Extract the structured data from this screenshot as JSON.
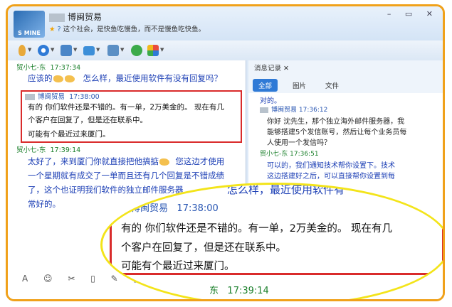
{
  "window": {
    "contact_name": "博闽贸易",
    "signature": "这个社会，是快鱼吃慢鱼，而不是慢鱼吃快鱼。",
    "logo_text": "S MINE",
    "controls": "– ▭ ✕"
  },
  "toolbar": {
    "icons": [
      "microphone-icon",
      "video-icon",
      "screen-icon",
      "folder-icon",
      "remote-icon",
      "add-app-icon",
      "apps-icon"
    ]
  },
  "chat": {
    "messages": [
      {
        "sender": "贸小七-东",
        "time": "17:37:34",
        "text_a": "应该的",
        "text_b": "怎么样，最近使用软件有没有回复吗？"
      },
      {
        "sender": "博闽贸易",
        "time": "17:38:00",
        "lines": [
          "有的 你们软件还是不错的。有一单，2万美金的。 现在有几",
          "个客户在回复了，但是还在联系中。",
          "可能有个最近过来厦门。"
        ]
      },
      {
        "sender": "贸小七-东",
        "time": "17:39:14",
        "lines": [
          "太好了，来到厦门你就直接把他搞掂",
          "您这边才使用",
          "一个星期就有成交了一单而且还有几个回复是不错成绩",
          "了，这个也证明我们软件的独立邮件服务器",
          "常好的。"
        ]
      }
    ],
    "input_tools": "A ☺ ✂ ▯ ✎ ▣"
  },
  "history": {
    "tab_label": "消息记录",
    "tab_close": "✕",
    "filters": [
      "全部",
      "图片",
      "文件"
    ],
    "entries": [
      {
        "text": "对的。"
      },
      {
        "sender": "博闽贸易",
        "time": "17:36:12",
        "lines": [
          "你好 沈先生，那个独立海外邮件服务器，我",
          "能够搭建5个发信账号，然后让每个业务员每",
          "人使用一个发信吗？"
        ]
      },
      {
        "sender": "贸小七-东",
        "time": "17:36:51",
        "lines": [
          "可以的，我们通知技术帮你设置下。技术",
          "这边搭建好之后，可以直接帮你设置到每"
        ]
      }
    ]
  },
  "zoom": {
    "header": "怎么样，最近使用软件有",
    "sender": "博闽贸易",
    "time": "17:38:00",
    "lines": [
      "有的 你们软件还是不错的。有一单，2万美金的。 现在有几",
      "个客户在回复了，但是还在联系中。",
      "可能有个最近过来厦门。"
    ],
    "footer_sender": "东",
    "footer_time": "17:39:14"
  },
  "colors": {
    "frame": "#f0a11a",
    "highlight_box": "#d92b2b",
    "zoom_ring": "#f3e41a",
    "accent": "#2f7ad6"
  }
}
